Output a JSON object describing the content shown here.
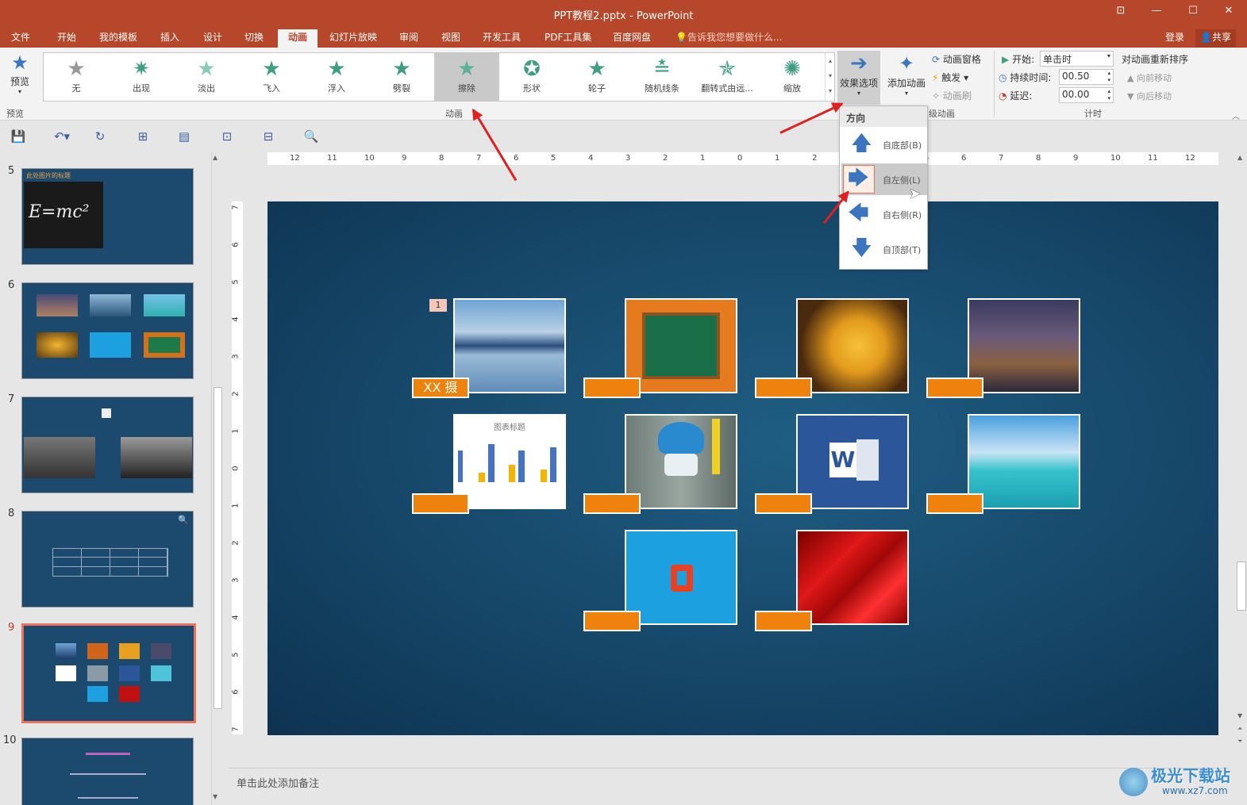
{
  "window": {
    "title": "PPT教程2.pptx - PowerPoint"
  },
  "tabs": [
    "文件",
    "开始",
    "我的模板",
    "插入",
    "设计",
    "切换",
    "动画",
    "幻灯片放映",
    "审阅",
    "视图",
    "开发工具",
    "PDF工具集",
    "百度网盘"
  ],
  "active_tab": "动画",
  "tell_me": "告诉我您想要做什么...",
  "account": {
    "login": "登录",
    "share": "共享"
  },
  "ribbon": {
    "preview": "预览",
    "animations": [
      "无",
      "出现",
      "淡出",
      "飞入",
      "浮入",
      "劈裂",
      "擦除",
      "形状",
      "轮子",
      "随机线条",
      "翻转式由远...",
      "缩放"
    ],
    "selected_animation": "擦除",
    "effect_options": "效果选项",
    "add_animation": "添加动画",
    "animation_pane": "动画窗格",
    "trigger": "触发",
    "animation_painter": "动画刷",
    "start_label": "开始:",
    "start_value": "单击时",
    "duration_label": "持续时间:",
    "duration_value": "00.50",
    "delay_label": "延迟:",
    "delay_value": "00.00",
    "reorder": "对动画重新排序",
    "move_earlier": "向前移动",
    "move_later": "向后移动",
    "groups": {
      "preview": "预览",
      "animation": "动画",
      "advanced": "级动画",
      "timing": "计时"
    }
  },
  "direction_menu": {
    "header": "方向",
    "items": [
      {
        "label": "自底部(B)",
        "icon": "arrow-up-icon"
      },
      {
        "label": "自左侧(L)",
        "icon": "arrow-right-icon"
      },
      {
        "label": "自右侧(R)",
        "icon": "arrow-left-icon"
      },
      {
        "label": "自顶部(T)",
        "icon": "arrow-down-icon"
      }
    ],
    "highlighted": "自左侧(L)"
  },
  "slide_numbers": [
    "5",
    "6",
    "7",
    "8",
    "9",
    "10"
  ],
  "selected_slide": "9",
  "thumb_texts": {
    "s5_title": "此处图片的标题",
    "s5_formula": "E=mc²",
    "s10_title": "..."
  },
  "ruler_h": [
    "12",
    "11",
    "10",
    "9",
    "8",
    "7",
    "6",
    "5",
    "4",
    "3",
    "2",
    "1",
    "0",
    "1",
    "2",
    "3",
    "4",
    "5",
    "6",
    "7",
    "8",
    "9",
    "10",
    "11",
    "12"
  ],
  "ruler_v": [
    "7",
    "6",
    "5",
    "4",
    "3",
    "2",
    "1",
    "0",
    "1",
    "2",
    "3",
    "4",
    "5",
    "6",
    "7"
  ],
  "slide": {
    "anim_tag": "1",
    "caption_first": "XX 摄",
    "chart_title": "图表标题",
    "word_letter": "W"
  },
  "notes_placeholder": "单击此处添加备注",
  "watermark": {
    "line1": "极光下载站",
    "line2": "www.xz7.com"
  }
}
